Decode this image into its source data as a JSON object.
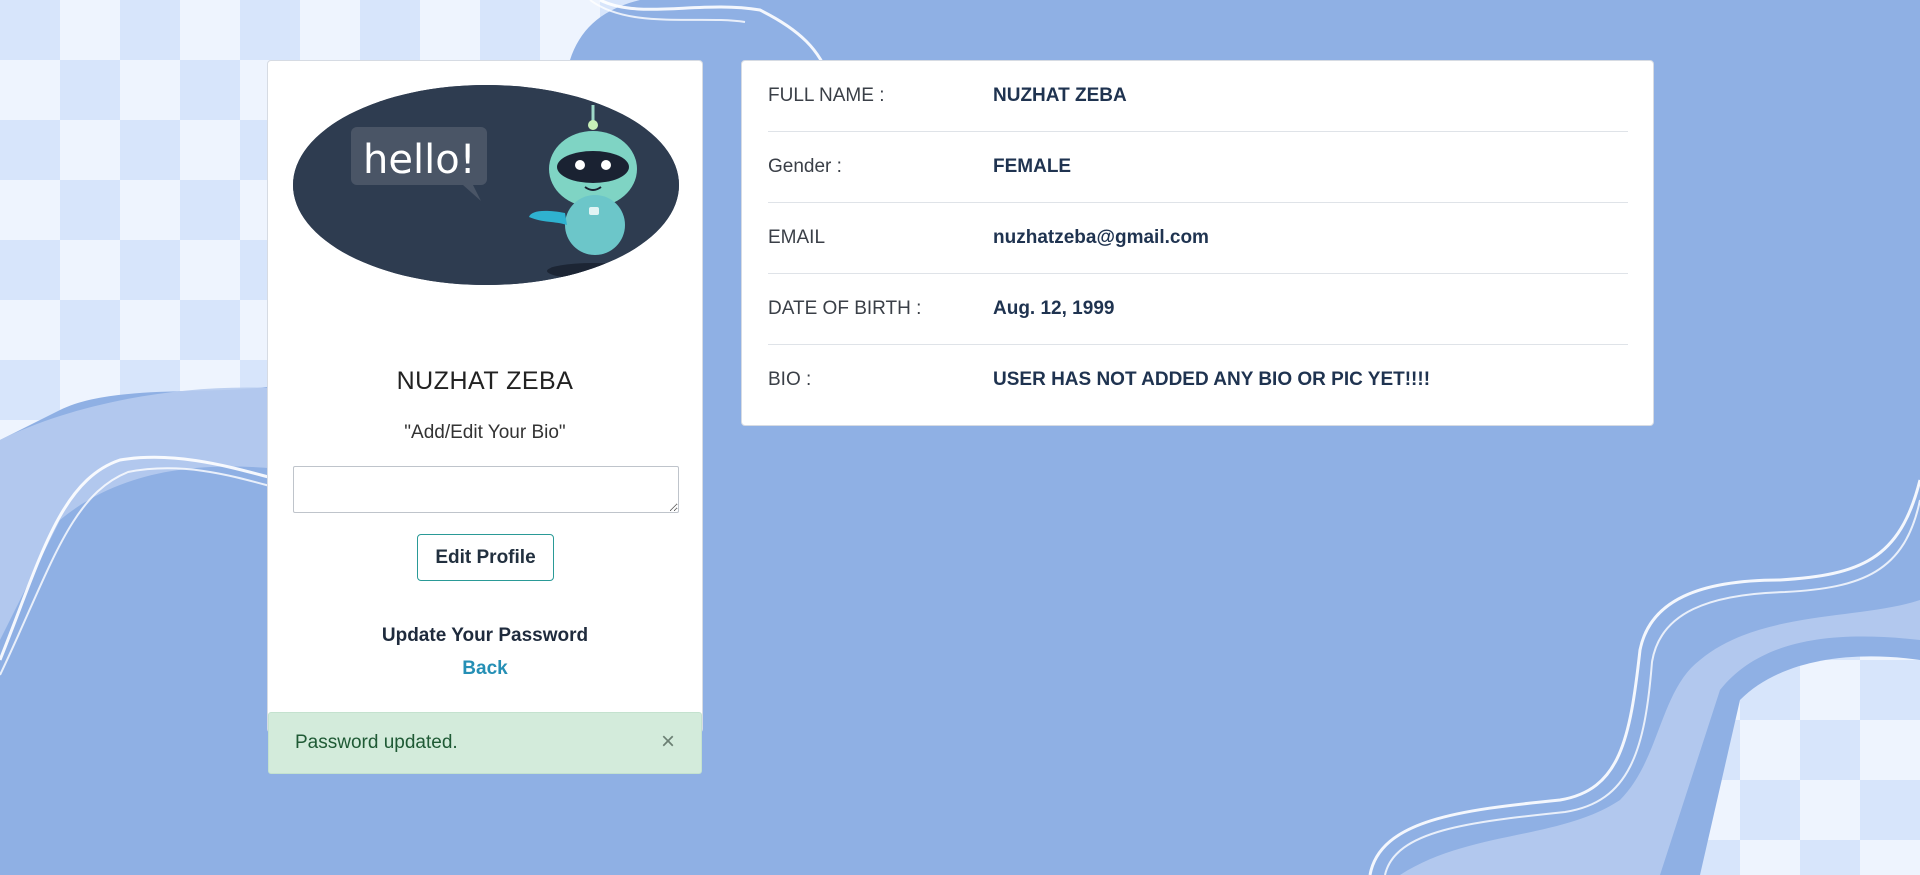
{
  "profile": {
    "name": "NUZHAT ZEBA",
    "bio_prompt": "\"Add/Edit Your Bio\"",
    "bio_value": "",
    "edit_button": "Edit Profile",
    "update_password_link": "Update Your Password",
    "back_link": "Back",
    "avatar_text": "hello!"
  },
  "alert": {
    "message": "Password updated.",
    "close_glyph": "×"
  },
  "details": [
    {
      "label": "FULL NAME :",
      "value": "NUZHAT ZEBA"
    },
    {
      "label": "Gender :",
      "value": "FEMALE"
    },
    {
      "label": "EMAIL",
      "value": "nuzhatzeba@gmail.com"
    },
    {
      "label": "DATE OF BIRTH :",
      "value": "Aug. 12, 1999"
    },
    {
      "label": "BIO :",
      "value": "USER HAS NOT ADDED ANY BIO OR PIC YET!!!!"
    }
  ],
  "colors": {
    "background": "#8fb0e4",
    "accent_teal": "#2a9a97",
    "link_blue": "#258fb5",
    "alert_bg": "#d3ebdb"
  }
}
